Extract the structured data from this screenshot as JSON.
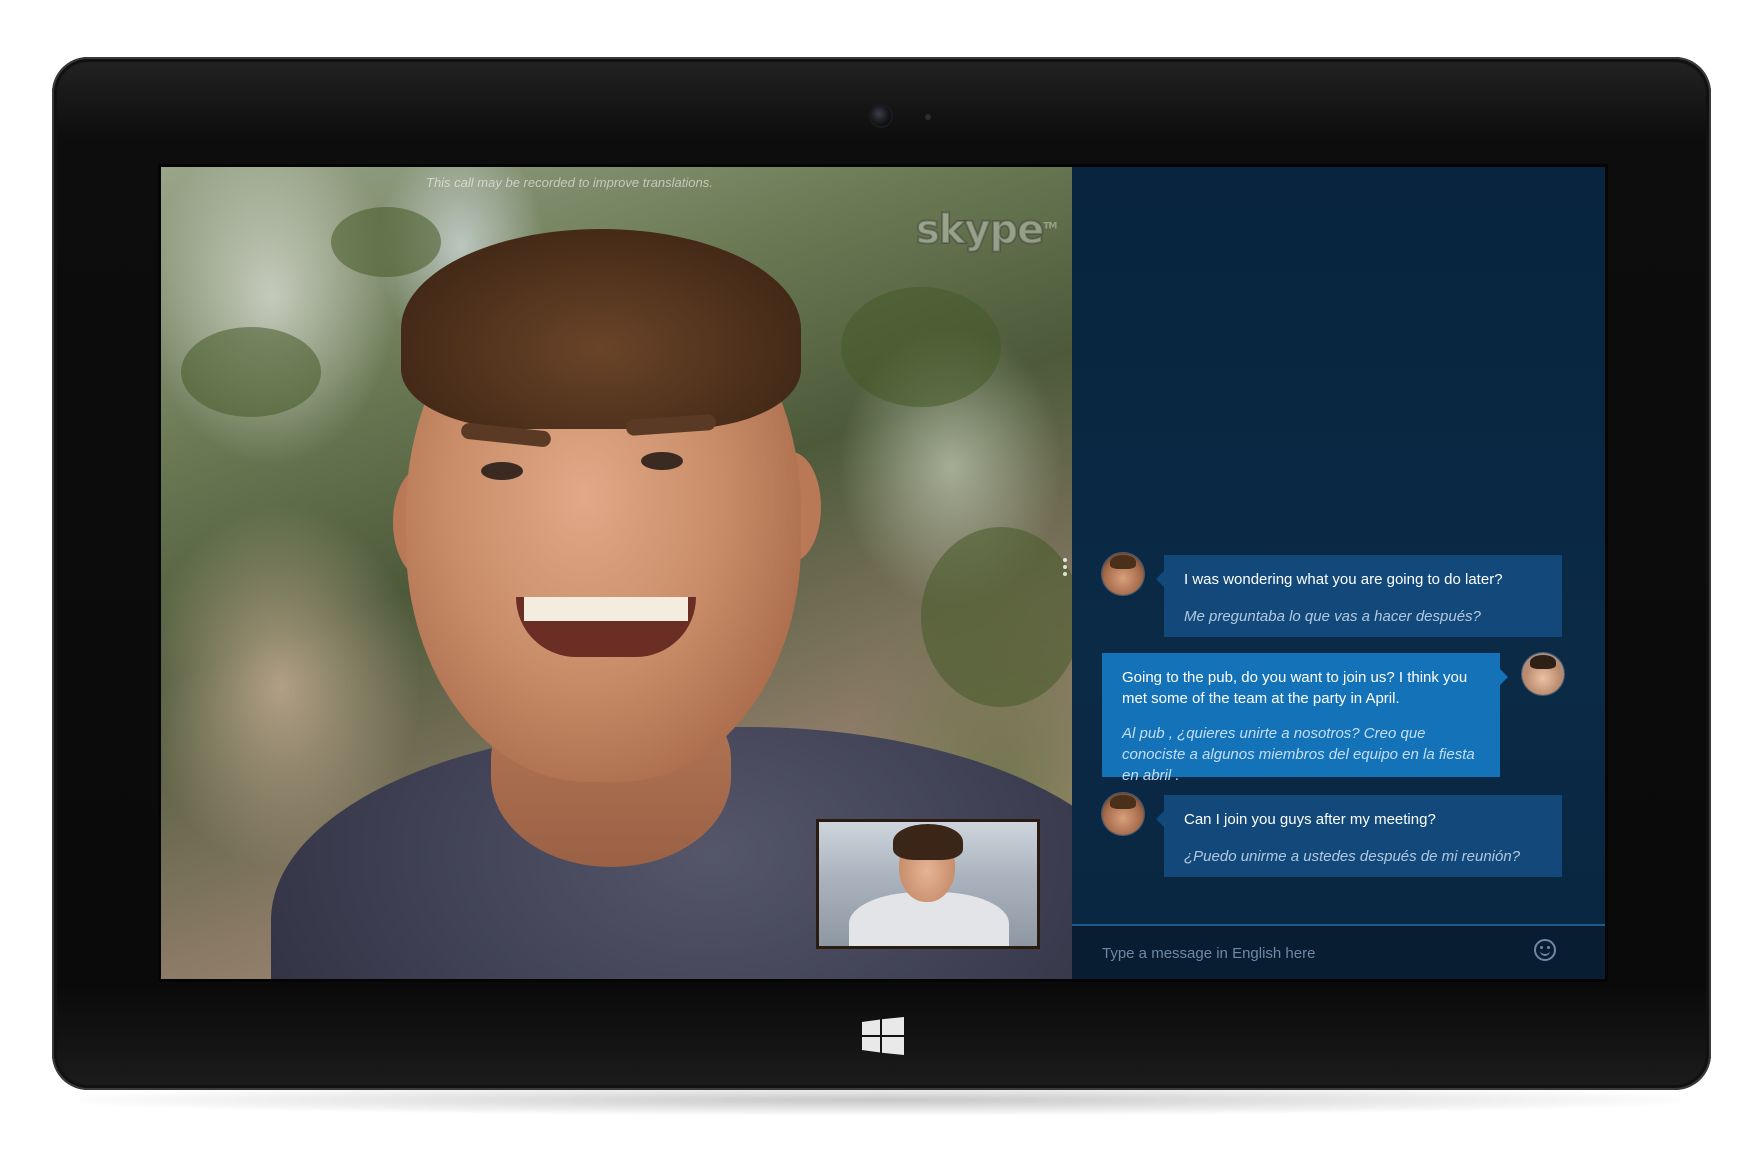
{
  "call": {
    "recording_notice": "This call may be recorded to improve translations.",
    "brand_logo": "skype",
    "brand_mark": "TM"
  },
  "chat": {
    "messages": [
      {
        "direction": "incoming",
        "text": "I was wondering what you are going to do later?",
        "translation": "Me preguntaba lo que vas a hacer después?"
      },
      {
        "direction": "outgoing",
        "text": "Going to the pub, do you want to join us? I think you met some of the team at the party in April.",
        "translation": "Al pub , ¿quieres unirte a nosotros? Creo que conociste a algunos miembros del equipo en la fiesta en abril ."
      },
      {
        "direction": "incoming",
        "text": "Can I join you guys after my meeting?",
        "translation": "¿Puedo unirme a ustedes después de mi reunión?"
      }
    ],
    "composer": {
      "placeholder": "Type a message in English here",
      "value": ""
    }
  },
  "icons": {
    "emoji": "smiley-icon",
    "panel_handle": "more-vertical-icon",
    "start": "windows-logo-icon",
    "camera": "camera-lens-icon"
  },
  "colors": {
    "chat_background": "#08243e",
    "incoming_bubble": "#12497a",
    "outgoing_bubble": "#1473b8",
    "composer_border": "#1a5a8e"
  }
}
